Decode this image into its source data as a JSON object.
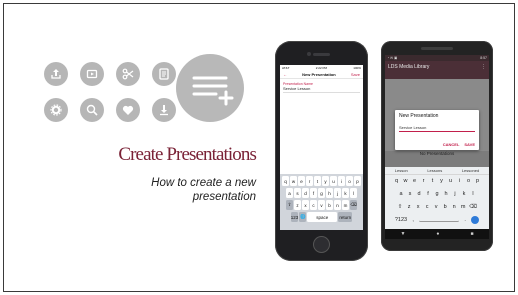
{
  "slide": {
    "title": "Create Presentations",
    "subtitle": "How to create a new presentation"
  },
  "icons": [
    "upload-icon",
    "media-icon",
    "scissors-icon",
    "document-icon",
    "settings-icon",
    "search-icon",
    "heart-icon",
    "download-icon"
  ],
  "big_icon": "add-to-list-icon",
  "iphone": {
    "status_left": "AT&T",
    "status_time": "2:22 PM",
    "status_right": "100%",
    "nav_back": "←",
    "nav_title": "New Presentation",
    "nav_save": "Save",
    "field_label": "Presentation Name",
    "field_value": "Service Lesson",
    "keyboard_rows": [
      [
        "q",
        "w",
        "e",
        "r",
        "t",
        "y",
        "u",
        "i",
        "o",
        "p"
      ],
      [
        "a",
        "s",
        "d",
        "f",
        "g",
        "h",
        "j",
        "k",
        "l"
      ],
      [
        "⇧",
        "z",
        "x",
        "c",
        "v",
        "b",
        "n",
        "m",
        "⌫"
      ]
    ],
    "key_123": "123",
    "key_globe": "🌐",
    "key_space": "space",
    "key_return": "return"
  },
  "android": {
    "status_right": "8:57",
    "app_title": "LDS Media Library",
    "dialog_title": "New Presentation",
    "dialog_input": "Service Lesson",
    "dialog_cancel": "CANCEL",
    "dialog_save": "SAVE",
    "empty_text": "No Presentations",
    "suggestions": [
      "Lesson",
      "Lessons",
      "Lessoned"
    ],
    "keyboard_rows": [
      [
        "q",
        "w",
        "e",
        "r",
        "t",
        "y",
        "u",
        "i",
        "o",
        "p"
      ],
      [
        "a",
        "s",
        "d",
        "f",
        "g",
        "h",
        "j",
        "k",
        "l"
      ],
      [
        "⇧",
        "z",
        "x",
        "c",
        "v",
        "b",
        "n",
        "m",
        "⌫"
      ]
    ],
    "key_sym": "?123",
    "key_comma": ",",
    "key_period": ".",
    "nav_back": "▼",
    "nav_home": "●",
    "nav_recent": "■"
  },
  "colors": {
    "title": "#7a2236",
    "icon_bg": "#b6b6b6",
    "accent": "#c21f4b",
    "android_appbar": "#4b2f37"
  }
}
